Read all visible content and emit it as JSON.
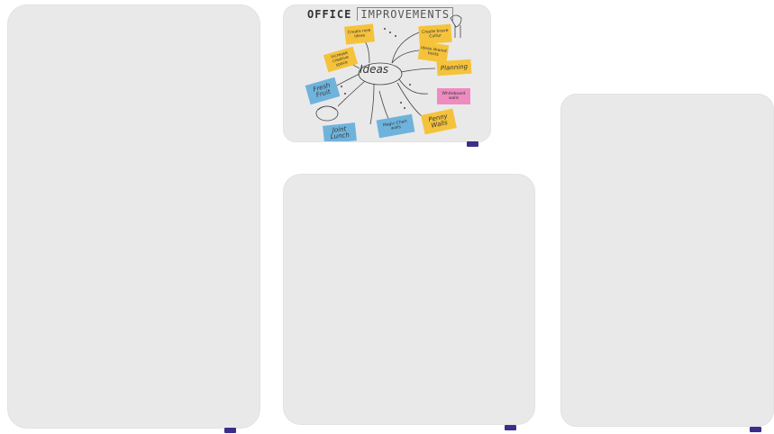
{
  "boards": [
    {
      "name": "whiteboard-tall-left"
    },
    {
      "name": "whiteboard-mindmap"
    },
    {
      "name": "whiteboard-square"
    },
    {
      "name": "whiteboard-tall-right"
    }
  ],
  "mindmap": {
    "title_part1": "OFFICE",
    "title_part2": "IMPROVEMENTS",
    "center": "Ideas",
    "notes": {
      "planning": "Planning",
      "fresh_fruit": "Fresh Fruit",
      "joint_lunch": "Joint Lunch",
      "penny_walls": "Penny Walls",
      "whiteboard_walls": "Whiteboard walls",
      "magic_chart": "Magic-Chart walls",
      "n1": "Create new ideas",
      "n2": "Create brave Cultur",
      "n3": "ideas shared hosts",
      "n4": "increase creative space"
    }
  },
  "colors": {
    "board": "#e9e9ea",
    "marker": "#3b2e8a",
    "note_yellow": "#f5c33b",
    "note_blue": "#6fb3dc",
    "note_pink": "#ee8cc0"
  }
}
